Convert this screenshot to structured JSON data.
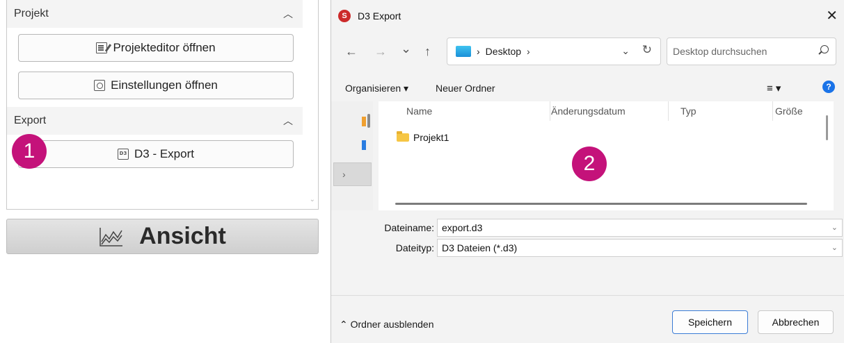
{
  "left_panel": {
    "sections": [
      {
        "title": "Projekt",
        "collapse_icon": "chevron-up-icon",
        "buttons": [
          {
            "label": "Projekteditor öffnen",
            "icon": "edit-icon"
          },
          {
            "label": "Einstellungen öffnen",
            "icon": "settings-icon"
          }
        ]
      },
      {
        "title": "Export",
        "collapse_icon": "chevron-up-icon",
        "buttons": [
          {
            "label": "D3 - Export",
            "icon": "d3-file-icon"
          }
        ]
      }
    ],
    "view_button": {
      "label": "Ansicht",
      "icon": "line-chart-icon"
    }
  },
  "annotations": {
    "step1": "1",
    "step2": "2",
    "color": "#c4127a"
  },
  "dialog": {
    "title": "D3 Export",
    "app_icon_letter": "S",
    "close_glyph": "✕",
    "nav": {
      "back": "←",
      "forward": "→",
      "recent": "⌄",
      "up": "↑"
    },
    "address": {
      "separator_1": "›",
      "location": "Desktop",
      "separator_2": "›",
      "dropdown": "⌄",
      "refresh": "↻"
    },
    "search": {
      "placeholder": "Desktop durchsuchen"
    },
    "commands": {
      "organize": "Organisieren ▾",
      "new_folder": "Neuer Ordner",
      "view": "≡ ▾",
      "help": "?"
    },
    "columns": [
      "Name",
      "Änderungsdatum",
      "Typ",
      "Größe"
    ],
    "files": [
      {
        "name": "Projekt1",
        "type": "folder"
      }
    ],
    "nav_pane": {
      "expand_glyph": "›"
    },
    "filename": {
      "label": "Dateiname:",
      "value": "export.d3"
    },
    "filetype": {
      "label": "Dateityp:",
      "value": "D3 Dateien (*.d3)"
    },
    "hide_folders": "⌃ Ordner ausblenden",
    "save_label": "Speichern",
    "cancel_label": "Abbrechen"
  }
}
